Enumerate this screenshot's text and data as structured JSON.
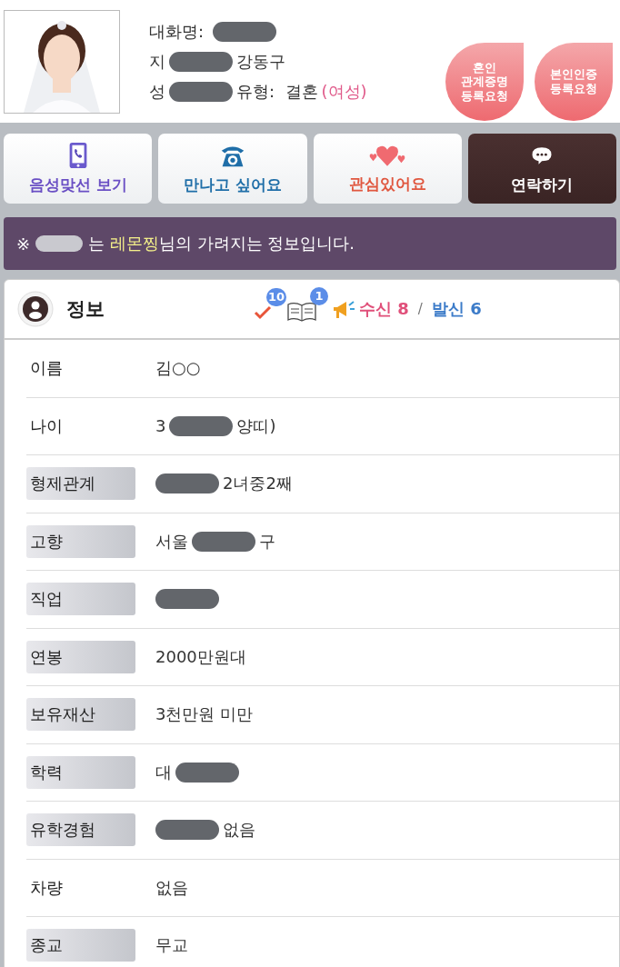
{
  "profile": {
    "photo": {
      "kind": "picture"
    },
    "lines": [
      [
        {
          "kind": "text",
          "text": "대화명: "
        },
        {
          "kind": "redacted"
        }
      ],
      [
        {
          "kind": "text",
          "text": "지"
        },
        {
          "kind": "redacted"
        },
        {
          "kind": "text",
          "text": "강동구"
        }
      ],
      [
        {
          "kind": "text",
          "text": "성"
        },
        {
          "kind": "redacted"
        },
        {
          "kind": "text",
          "text": "유형:  결혼"
        },
        {
          "kind": "accent",
          "text": "(여성)"
        }
      ]
    ],
    "badges": [
      [
        "혼인",
        "관계증명",
        "등록요청"
      ],
      [
        "본인인증",
        "등록요청"
      ]
    ]
  },
  "actions": [
    {
      "kind": "voice",
      "label": "음성맞선 보기"
    },
    {
      "kind": "meet",
      "label": "만나고 싶어요"
    },
    {
      "kind": "like",
      "label": "관심있어요"
    },
    {
      "kind": "contact",
      "label": "연락하기"
    }
  ],
  "notice": {
    "mark": "※",
    "before": "는 ",
    "nickname": "레몬찡",
    "after": "님의 가려지는 정보입니다."
  },
  "info": {
    "title": "정보",
    "check_count": "10",
    "book_count": "1",
    "received": "수신 8",
    "separator": "/",
    "sent": "발신 6",
    "rows": [
      {
        "label": "이름",
        "highlighted": false,
        "value": [
          {
            "kind": "text",
            "text": "김○○"
          }
        ]
      },
      {
        "label": "나이",
        "highlighted": false,
        "value": [
          {
            "kind": "text",
            "text": "3"
          },
          {
            "kind": "redacted"
          },
          {
            "kind": "text",
            "text": "양띠)"
          }
        ]
      },
      {
        "label": "형제관계",
        "highlighted": true,
        "value": [
          {
            "kind": "redacted"
          },
          {
            "kind": "text",
            "text": "2녀중2째"
          }
        ]
      },
      {
        "label": "고향",
        "highlighted": true,
        "value": [
          {
            "kind": "text",
            "text": "서울"
          },
          {
            "kind": "redacted"
          },
          {
            "kind": "text",
            "text": "구"
          }
        ]
      },
      {
        "label": "직업",
        "highlighted": true,
        "value": [
          {
            "kind": "redacted"
          }
        ]
      },
      {
        "label": "연봉",
        "highlighted": true,
        "value": [
          {
            "kind": "text",
            "text": "2000만원대"
          }
        ]
      },
      {
        "label": "보유재산",
        "highlighted": true,
        "value": [
          {
            "kind": "text",
            "text": "3천만원 미만"
          }
        ]
      },
      {
        "label": "학력",
        "highlighted": true,
        "value": [
          {
            "kind": "text",
            "text": "대"
          },
          {
            "kind": "redacted"
          }
        ]
      },
      {
        "label": "유학경험",
        "highlighted": true,
        "value": [
          {
            "kind": "redacted"
          },
          {
            "kind": "text",
            "text": "없음"
          }
        ]
      },
      {
        "label": "차량",
        "highlighted": false,
        "value": [
          {
            "kind": "text",
            "text": "없음"
          }
        ]
      },
      {
        "label": "종교",
        "highlighted": true,
        "value": [
          {
            "kind": "text",
            "text": "무교"
          }
        ]
      }
    ]
  }
}
